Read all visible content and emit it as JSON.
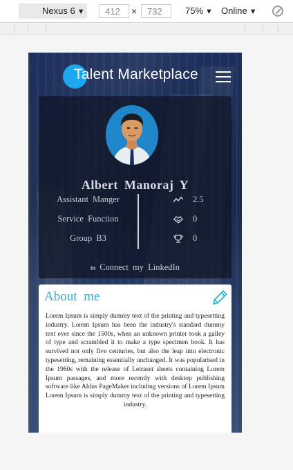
{
  "devtools": {
    "device": "Nexus 6",
    "width": "412",
    "height": "732",
    "times": "×",
    "zoom": "75%",
    "network": "Online"
  },
  "app": {
    "brand": "Talent Marketplace"
  },
  "profile": {
    "name": "Albert  Manoraj  Y",
    "details": [
      "Assistant  Manger",
      "Service  Function",
      "Group  B3"
    ],
    "stats": [
      {
        "icon": "trend-icon",
        "value": "2.5"
      },
      {
        "icon": "handshake-icon",
        "value": "0"
      },
      {
        "icon": "trophy-icon",
        "value": "0"
      }
    ],
    "linkedin_icon": "in",
    "linkedin": "Connect  my  LinkedIn"
  },
  "about": {
    "title": "About  me",
    "text": "Lorem Ipsum is simply dummy text of the printing and typesetting industry. Lorem Ipsum has been the industry's standard dummy text ever since the 1500s, when an unknown printer took a galley of type and scrambled it to make a type specimen book. It has survived not only five centuries, but also the leap into electronic typesetting, remaining essentially unchanged. It was popularised in the 1960s with the release of Letraset sheets containing Lorem Ipsum passages, and more recently with desktop publishing software like Aldus PageMaker including versions of Lorem Ipsum Lorem Ipsum is simply dummy text of the printing and typesetting industry."
  },
  "colors": {
    "accent": "#26b3d8",
    "logo": "#1fa6f0",
    "avatar_bg": "#1f86c9"
  }
}
